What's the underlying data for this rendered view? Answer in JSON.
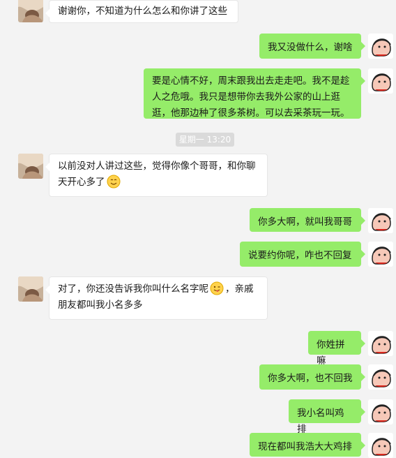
{
  "messages": [
    {
      "side": "in",
      "text": "谢谢你，不知道为什么怎么和你讲了这些"
    },
    {
      "side": "out",
      "text": "我又没做什么，谢啥"
    },
    {
      "side": "out",
      "text": "要是心情不好，周末跟我出去走走吧。我不是趁人之危哦。我只是想带你去我外公家的山上逛逛，他那边种了很多茶树。可以去采茶玩一玩。"
    },
    {
      "side": "in",
      "text": "以前没对人讲过这些，觉得你像个哥哥，和你聊天开心多了",
      "emoji": "smile-emoji"
    },
    {
      "side": "out",
      "text": "你多大啊，就叫我哥哥"
    },
    {
      "side": "out",
      "text": "说要约你呢，咋也不回复"
    },
    {
      "side": "in",
      "text_before": "对了，你还没告诉我你叫什么名字呢",
      "emoji": "wink-tongue-emoji",
      "text_after": "，亲戚朋友都叫我小名多多"
    },
    {
      "side": "out",
      "text": "你姓拼嘛"
    },
    {
      "side": "out",
      "text": "你多大啊，也不回我"
    },
    {
      "side": "out",
      "text": "我小名叫鸡排"
    },
    {
      "side": "out",
      "text": "现在都叫我浩大大鸡排"
    }
  ],
  "timestamp": "星期一 13:20",
  "colors": {
    "out_bubble": "#95ec69",
    "in_bubble": "#ffffff",
    "background": "#f3f3f3"
  }
}
